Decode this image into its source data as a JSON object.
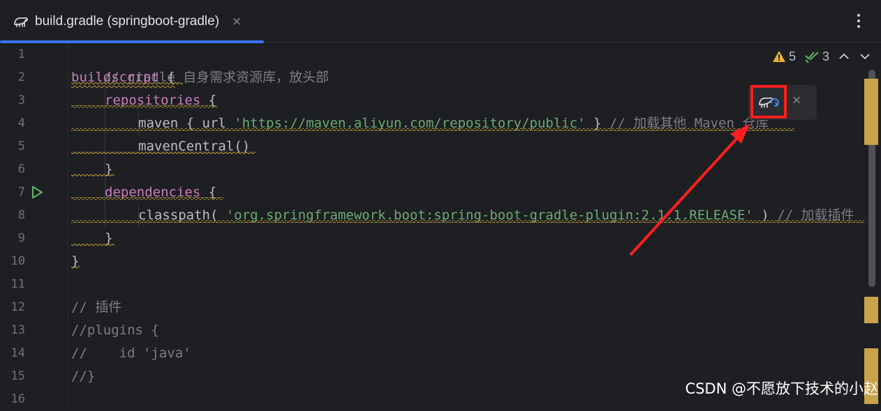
{
  "tab": {
    "title": "build.gradle (springboot-gradle)",
    "close": "×"
  },
  "inspections": {
    "warnings": "5",
    "weak_warnings": "3"
  },
  "sync_popup": {
    "close": "×"
  },
  "line_numbers": [
    "1",
    "2",
    "3",
    "4",
    "5",
    "6",
    "7",
    "8",
    "9",
    "10",
    "11",
    "12",
    "13",
    "14",
    "15",
    "16"
  ],
  "code": {
    "l1": "// gradle 自身需求资源库，放头部",
    "l2_kw": "buildscript",
    "l2_brace": " {",
    "l3_kw": "repositories",
    "l3_brace": " {",
    "l4_a": "maven",
    "l4_b": " { url ",
    "l4_str": "'https://maven.aliyun.com/repository/public'",
    "l4_c": " } ",
    "l4_cmt": "// 加载其他 Maven 仓库",
    "l5": "mavenCentral()",
    "l6": "}",
    "l7_kw": "dependencies",
    "l7_brace": " {",
    "l8_a": "classpath( ",
    "l8_str": "'org.springframework.boot:spring-boot-gradle-plugin:2.1.1.RELEASE'",
    "l8_b": " ) ",
    "l8_cmt": "// 加载插件",
    "l9": "}",
    "l10": "}",
    "l12": "// 插件",
    "l13": "//plugins {",
    "l14": "//    id 'java'",
    "l15": "//}"
  },
  "watermark": "CSDN @不愿放下技术的小赵",
  "colors": {
    "accent": "#3574f0",
    "highlight": "#ff1f1f",
    "warning": "#e8b33a",
    "ok": "#5fb865"
  }
}
